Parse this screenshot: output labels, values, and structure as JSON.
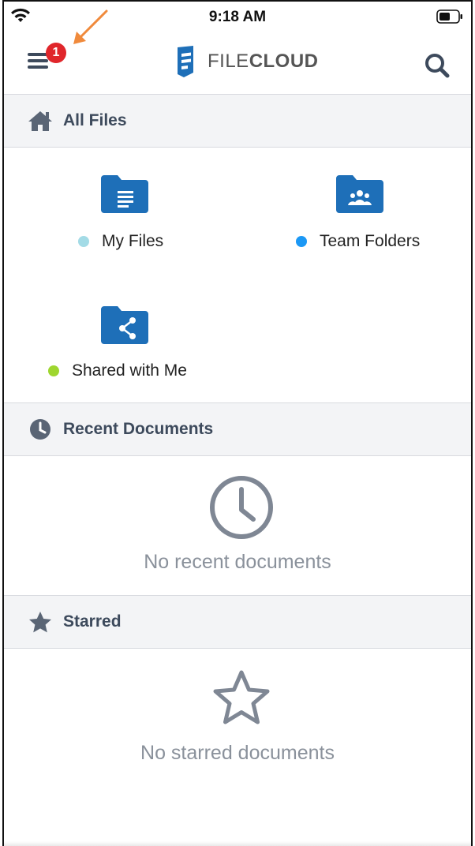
{
  "status_bar": {
    "time": "9:18 AM"
  },
  "header": {
    "logo_text_light": "FILE",
    "logo_text_bold": "CLOUD",
    "menu_badge_count": "1",
    "icons": [
      "menu-icon",
      "search-icon",
      "filecloud-logo"
    ]
  },
  "all_files": {
    "title": "All Files",
    "folders": [
      {
        "label": "My Files",
        "dot_color": "#a3dbe6",
        "icon": "document-folder-icon"
      },
      {
        "label": "Team Folders",
        "dot_color": "#1b98f5",
        "icon": "team-folder-icon"
      },
      {
        "label": "Shared with Me",
        "dot_color": "#9ed62f",
        "icon": "shared-folder-icon"
      }
    ]
  },
  "recent": {
    "title": "Recent Documents",
    "empty_text": "No recent documents"
  },
  "starred": {
    "title": "Starred",
    "empty_text": "No starred documents"
  },
  "colors": {
    "folder_blue": "#1e6fb8",
    "badge_red": "#e0262b",
    "arrow_orange": "#f08a3c",
    "section_text": "#3d4a5c",
    "empty_gray": "#8a919b"
  }
}
